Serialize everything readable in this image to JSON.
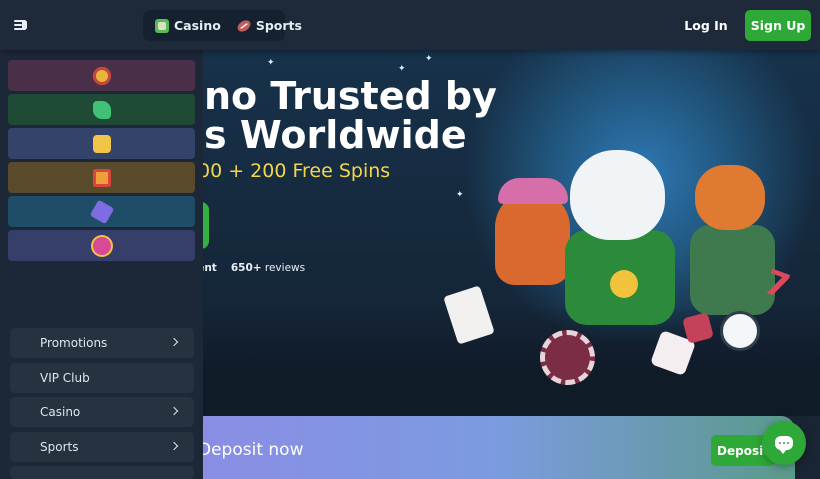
{
  "header": {
    "casino_label": "Casino",
    "sports_label": "Sports",
    "login_label": "Log In",
    "signup_label": "Sign Up"
  },
  "hero": {
    "headline_line1": "no Trusted by",
    "headline_line2": "s Worldwide",
    "offer": "00 + 200 Free Spins",
    "rating_word": "llent",
    "reviews_count": "650+",
    "reviews_label": "reviews"
  },
  "sidebar": {
    "game_tiles": [
      {
        "icon": "wheel-icon",
        "bg": "#4a2f49",
        "color": "#e7b43c"
      },
      {
        "icon": "dragon-icon",
        "bg": "#1f4a35",
        "color": "#3fc276"
      },
      {
        "icon": "fruit-icon",
        "bg": "#33436a",
        "color": "#f0c447"
      },
      {
        "icon": "gift-icon",
        "bg": "#5a4a2c",
        "color": "#ef9f3a"
      },
      {
        "icon": "ticket-icon",
        "bg": "#1f4d68",
        "color": "#7e6de2"
      },
      {
        "icon": "jackpot-icon",
        "bg": "#353f6a",
        "color": "#d84a96"
      }
    ],
    "nav": [
      {
        "label": "Promotions",
        "chevron": true
      },
      {
        "label": "VIP Club",
        "chevron": false
      },
      {
        "label": "Casino",
        "chevron": true
      },
      {
        "label": "Sports",
        "chevron": true
      }
    ]
  },
  "deposit": {
    "banner_text": "Deposit now",
    "button_label": "Deposit"
  },
  "colors": {
    "accent_green": "#2ea836",
    "offer_yellow": "#f3d64b"
  }
}
